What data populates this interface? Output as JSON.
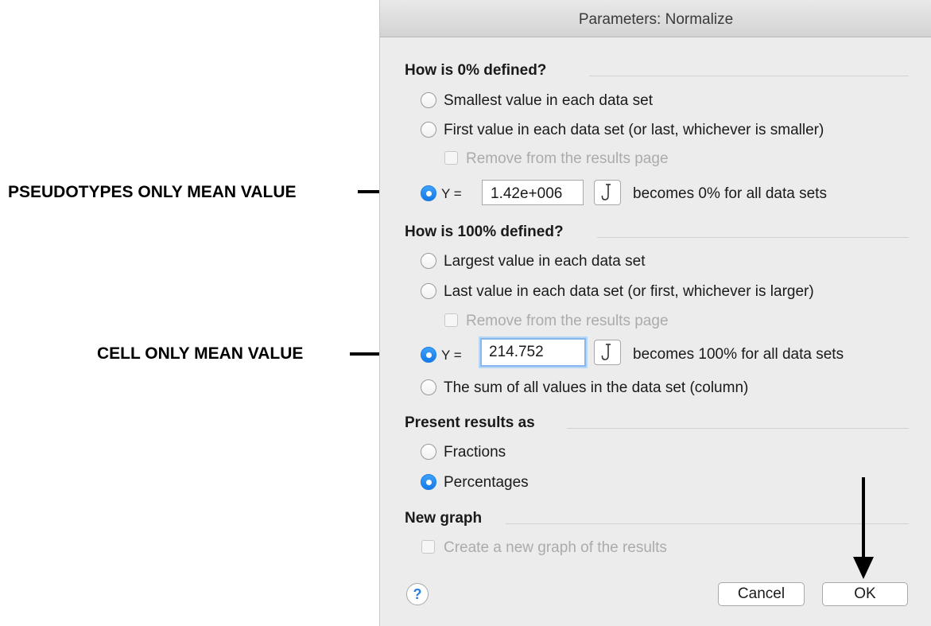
{
  "dialog": {
    "title": "Parameters: Normalize",
    "zero_section": {
      "title": "How is 0% defined?",
      "options": [
        "Smallest value in each data set",
        "First value in each data set (or last, whichever is smaller)"
      ],
      "remove_checkbox": "Remove from the results page",
      "y_label": "Y =",
      "y_value": "1.42e+006",
      "suffix": "becomes 0% for all data sets",
      "selected": "y_value"
    },
    "hundred_section": {
      "title": "How is 100% defined?",
      "options": [
        "Largest value in each data set",
        "Last value in each data set (or first, whichever is larger)"
      ],
      "remove_checkbox": "Remove from the results page",
      "y_label": "Y =",
      "y_value": "214.752",
      "suffix": "becomes 100% for all data sets",
      "sum_option": "The sum of all values in the data set (column)",
      "selected": "y_value"
    },
    "present_section": {
      "title": "Present results as",
      "options": [
        "Fractions",
        "Percentages"
      ],
      "selected": "Percentages"
    },
    "graph_section": {
      "title": "New graph",
      "checkbox": "Create a new graph of the results"
    },
    "help_label": "?",
    "cancel_label": "Cancel",
    "ok_label": "OK",
    "hook_icon": "hook-icon",
    "accent_color": "#1479e5"
  },
  "annotations": {
    "pseudotypes": "PSEUDOTYPES ONLY MEAN VALUE",
    "cell": "CELL ONLY MEAN VALUE"
  }
}
